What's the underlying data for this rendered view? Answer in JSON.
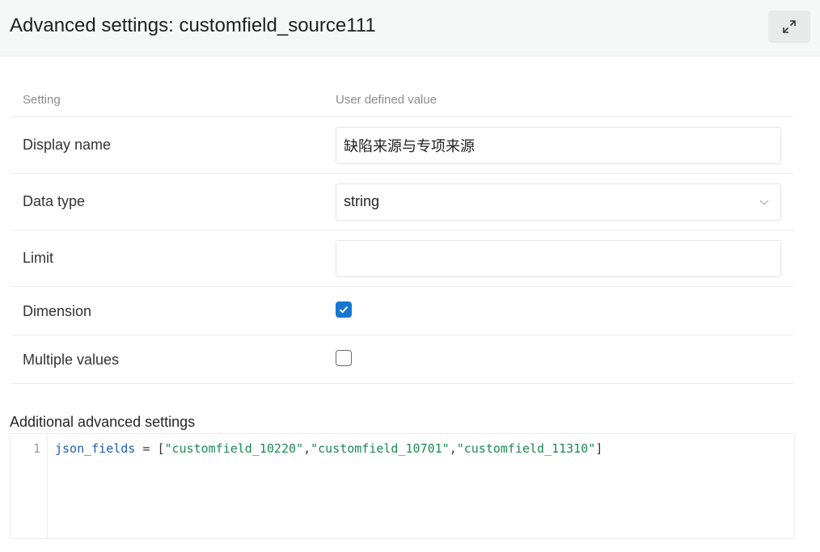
{
  "header": {
    "title": "Advanced settings: customfield_source111",
    "expand_icon": "expand-arrows-icon"
  },
  "table": {
    "columns": [
      "Setting",
      "User defined value"
    ],
    "rows": {
      "display_name": {
        "label": "Display name",
        "value": "缺陷来源与专项来源"
      },
      "data_type": {
        "label": "Data type",
        "value": "string"
      },
      "limit": {
        "label": "Limit",
        "value": ""
      },
      "dimension": {
        "label": "Dimension",
        "checked": true
      },
      "multiple_values": {
        "label": "Multiple values",
        "checked": false
      }
    }
  },
  "additional": {
    "title": "Additional advanced settings",
    "line_number": "1",
    "code": {
      "key": "json_fields",
      "op": " = ",
      "open": "[",
      "items": [
        "\"customfield_10220\"",
        "\"customfield_10701\"",
        "\"customfield_11310\""
      ],
      "sep": ",",
      "close": "]"
    }
  },
  "colors": {
    "accent": "#1677d2",
    "header_bg": "#f6f8f7",
    "code_key": "#1a5fb4",
    "code_string": "#1c8a52"
  }
}
